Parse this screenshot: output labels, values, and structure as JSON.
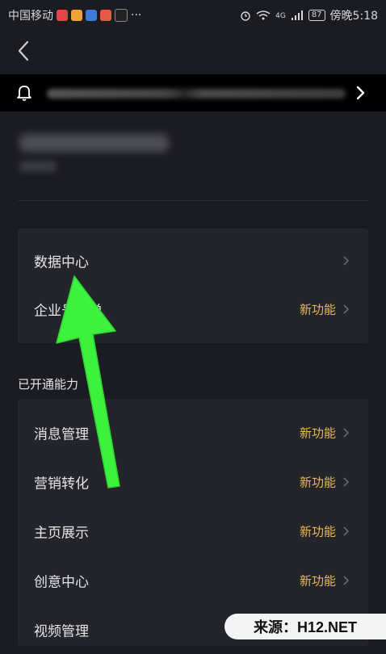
{
  "status_bar": {
    "carrier": "中国移动",
    "more": "···",
    "network": "4G",
    "battery": "87",
    "time": "傍晚5:18"
  },
  "notice_bar": {
    "icons": [
      "bell-icon",
      "chevron-right-icon"
    ]
  },
  "card1": {
    "items": [
      {
        "label": "数据中心",
        "tag": ""
      },
      {
        "label": "企业号菜单",
        "tag": "新功能"
      }
    ]
  },
  "section": {
    "title": "已开通能力"
  },
  "card2": {
    "items": [
      {
        "label": "消息管理",
        "tag": "新功能"
      },
      {
        "label": "营销转化",
        "tag": "新功能"
      },
      {
        "label": "主页展示",
        "tag": "新功能"
      },
      {
        "label": "创意中心",
        "tag": "新功能"
      },
      {
        "label": "视频管理",
        "tag": ""
      }
    ]
  },
  "watermark": {
    "text": "来源：H12.NET"
  },
  "colors": {
    "background": "#1b1c22",
    "card": "#24252b",
    "new_tag": "#e8b84d",
    "annotation_arrow": "#3cf23c"
  }
}
